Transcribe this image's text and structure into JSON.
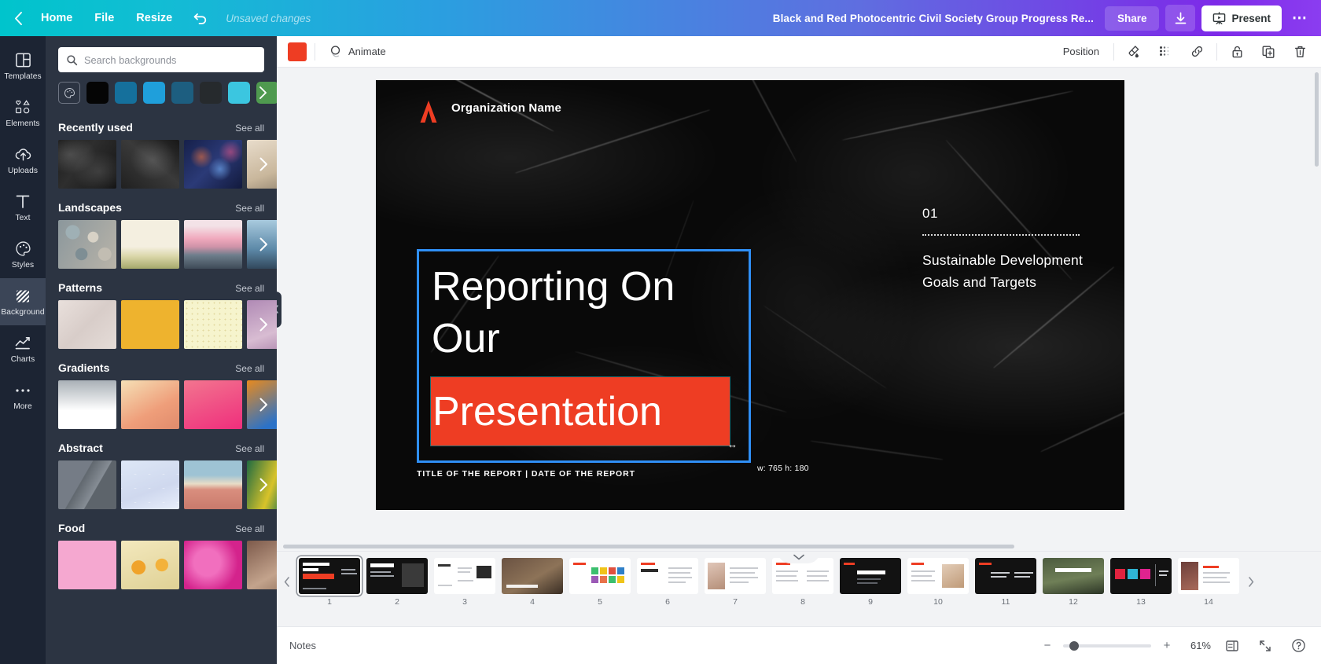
{
  "topbar": {
    "back_icon": "chevron-left-icon",
    "home_label": "Home",
    "file_label": "File",
    "resize_label": "Resize",
    "undo_icon": "undo-icon",
    "save_status": "Unsaved changes",
    "doc_title": "Black and Red Photocentric Civil Society Group Progress Re...",
    "share_label": "Share",
    "download_icon": "download-icon",
    "present_icon": "present-icon",
    "present_label": "Present",
    "more_label": "⋯",
    "gradient_start": "#00c4cc",
    "gradient_end": "#8b3df0"
  },
  "rail": {
    "items": [
      {
        "label": "Templates",
        "icon": "templates-icon",
        "active": false
      },
      {
        "label": "Elements",
        "icon": "elements-icon",
        "active": false
      },
      {
        "label": "Uploads",
        "icon": "uploads-icon",
        "active": false
      },
      {
        "label": "Text",
        "icon": "text-icon",
        "active": false
      },
      {
        "label": "Styles",
        "icon": "styles-icon",
        "active": false
      },
      {
        "label": "Background",
        "icon": "background-icon",
        "active": true
      },
      {
        "label": "Charts",
        "icon": "charts-icon",
        "active": false
      },
      {
        "label": "More",
        "icon": "more-icon",
        "active": false
      }
    ]
  },
  "panel": {
    "search_placeholder": "Search backgrounds",
    "search_value": "",
    "search_icon": "search-icon",
    "swatch_picker_icon": "color-wheel-icon",
    "swatches": [
      "#050505",
      "#15709c",
      "#1f9fdb",
      "#1d5e80",
      "#262a2d",
      "#3bc6e0",
      "#4f9a4f"
    ],
    "see_all_label": "See all",
    "sections": [
      {
        "title": "Recently used",
        "thumbs": [
          "t-marble1",
          "t-marble2",
          "t-city",
          "t-sand"
        ]
      },
      {
        "title": "Landscapes",
        "thumbs": [
          "t-pebbles",
          "t-field",
          "t-pinksky",
          "t-bluesky"
        ]
      },
      {
        "title": "Patterns",
        "thumbs": [
          "t-paper",
          "t-yellow",
          "t-dots",
          "t-purple"
        ]
      },
      {
        "title": "Gradients",
        "thumbs": [
          "t-gwhite",
          "t-gpeach",
          "t-gpink",
          "t-gblue"
        ]
      },
      {
        "title": "Abstract",
        "thumbs": [
          "t-abs1",
          "t-abs2",
          "t-abs3",
          "t-abs4"
        ]
      },
      {
        "title": "Food",
        "thumbs": [
          "t-f1",
          "t-f2",
          "t-f3",
          "t-f4"
        ]
      }
    ]
  },
  "editor_toolbar": {
    "color_chip": "#ee3d23",
    "animate_icon": "animate-icon",
    "animate_label": "Animate",
    "position_label": "Position",
    "transparency_icon": "transparency-icon",
    "effects_icon": "effects-icon",
    "link_icon": "link-icon",
    "lock_icon": "lock-icon",
    "duplicate_icon": "duplicate-icon",
    "delete_icon": "trash-icon"
  },
  "slide": {
    "logo_icon": "organization-logo-icon",
    "logo_color": "#ee3d23",
    "organization_name": "Organization Name",
    "title_line1": "Reporting On",
    "title_line2": "Our",
    "title_line3": "Presentation",
    "highlight_color": "#ee3d23",
    "section_number": "01",
    "section_title": "Sustainable Development Goals and Targets",
    "footer": "TITLE OF THE REPORT  |  DATE OF THE REPORT",
    "selection_dimensions": "w: 765 h: 180",
    "selection_border_color": "#2f8ff5"
  },
  "pagestrip": {
    "collapse_icon": "chevron-down-icon",
    "prev_icon": "chevron-left-icon",
    "next_icon": "chevron-right-icon",
    "pages": [
      {
        "num": "1",
        "active": true
      },
      {
        "num": "2",
        "active": false
      },
      {
        "num": "3",
        "active": false
      },
      {
        "num": "4",
        "active": false
      },
      {
        "num": "5",
        "active": false
      },
      {
        "num": "6",
        "active": false
      },
      {
        "num": "7",
        "active": false
      },
      {
        "num": "8",
        "active": false
      },
      {
        "num": "9",
        "active": false
      },
      {
        "num": "10",
        "active": false
      },
      {
        "num": "11",
        "active": false
      },
      {
        "num": "12",
        "active": false
      },
      {
        "num": "13",
        "active": false
      },
      {
        "num": "14",
        "active": false
      }
    ]
  },
  "notesbar": {
    "notes_label": "Notes",
    "zoom_minus": "−",
    "zoom_plus": "+",
    "zoom_value": "61%",
    "zoom_percent": 61,
    "pages_icon": "page-count-icon",
    "fullscreen_icon": "fullscreen-icon",
    "help_icon": "help-icon"
  }
}
